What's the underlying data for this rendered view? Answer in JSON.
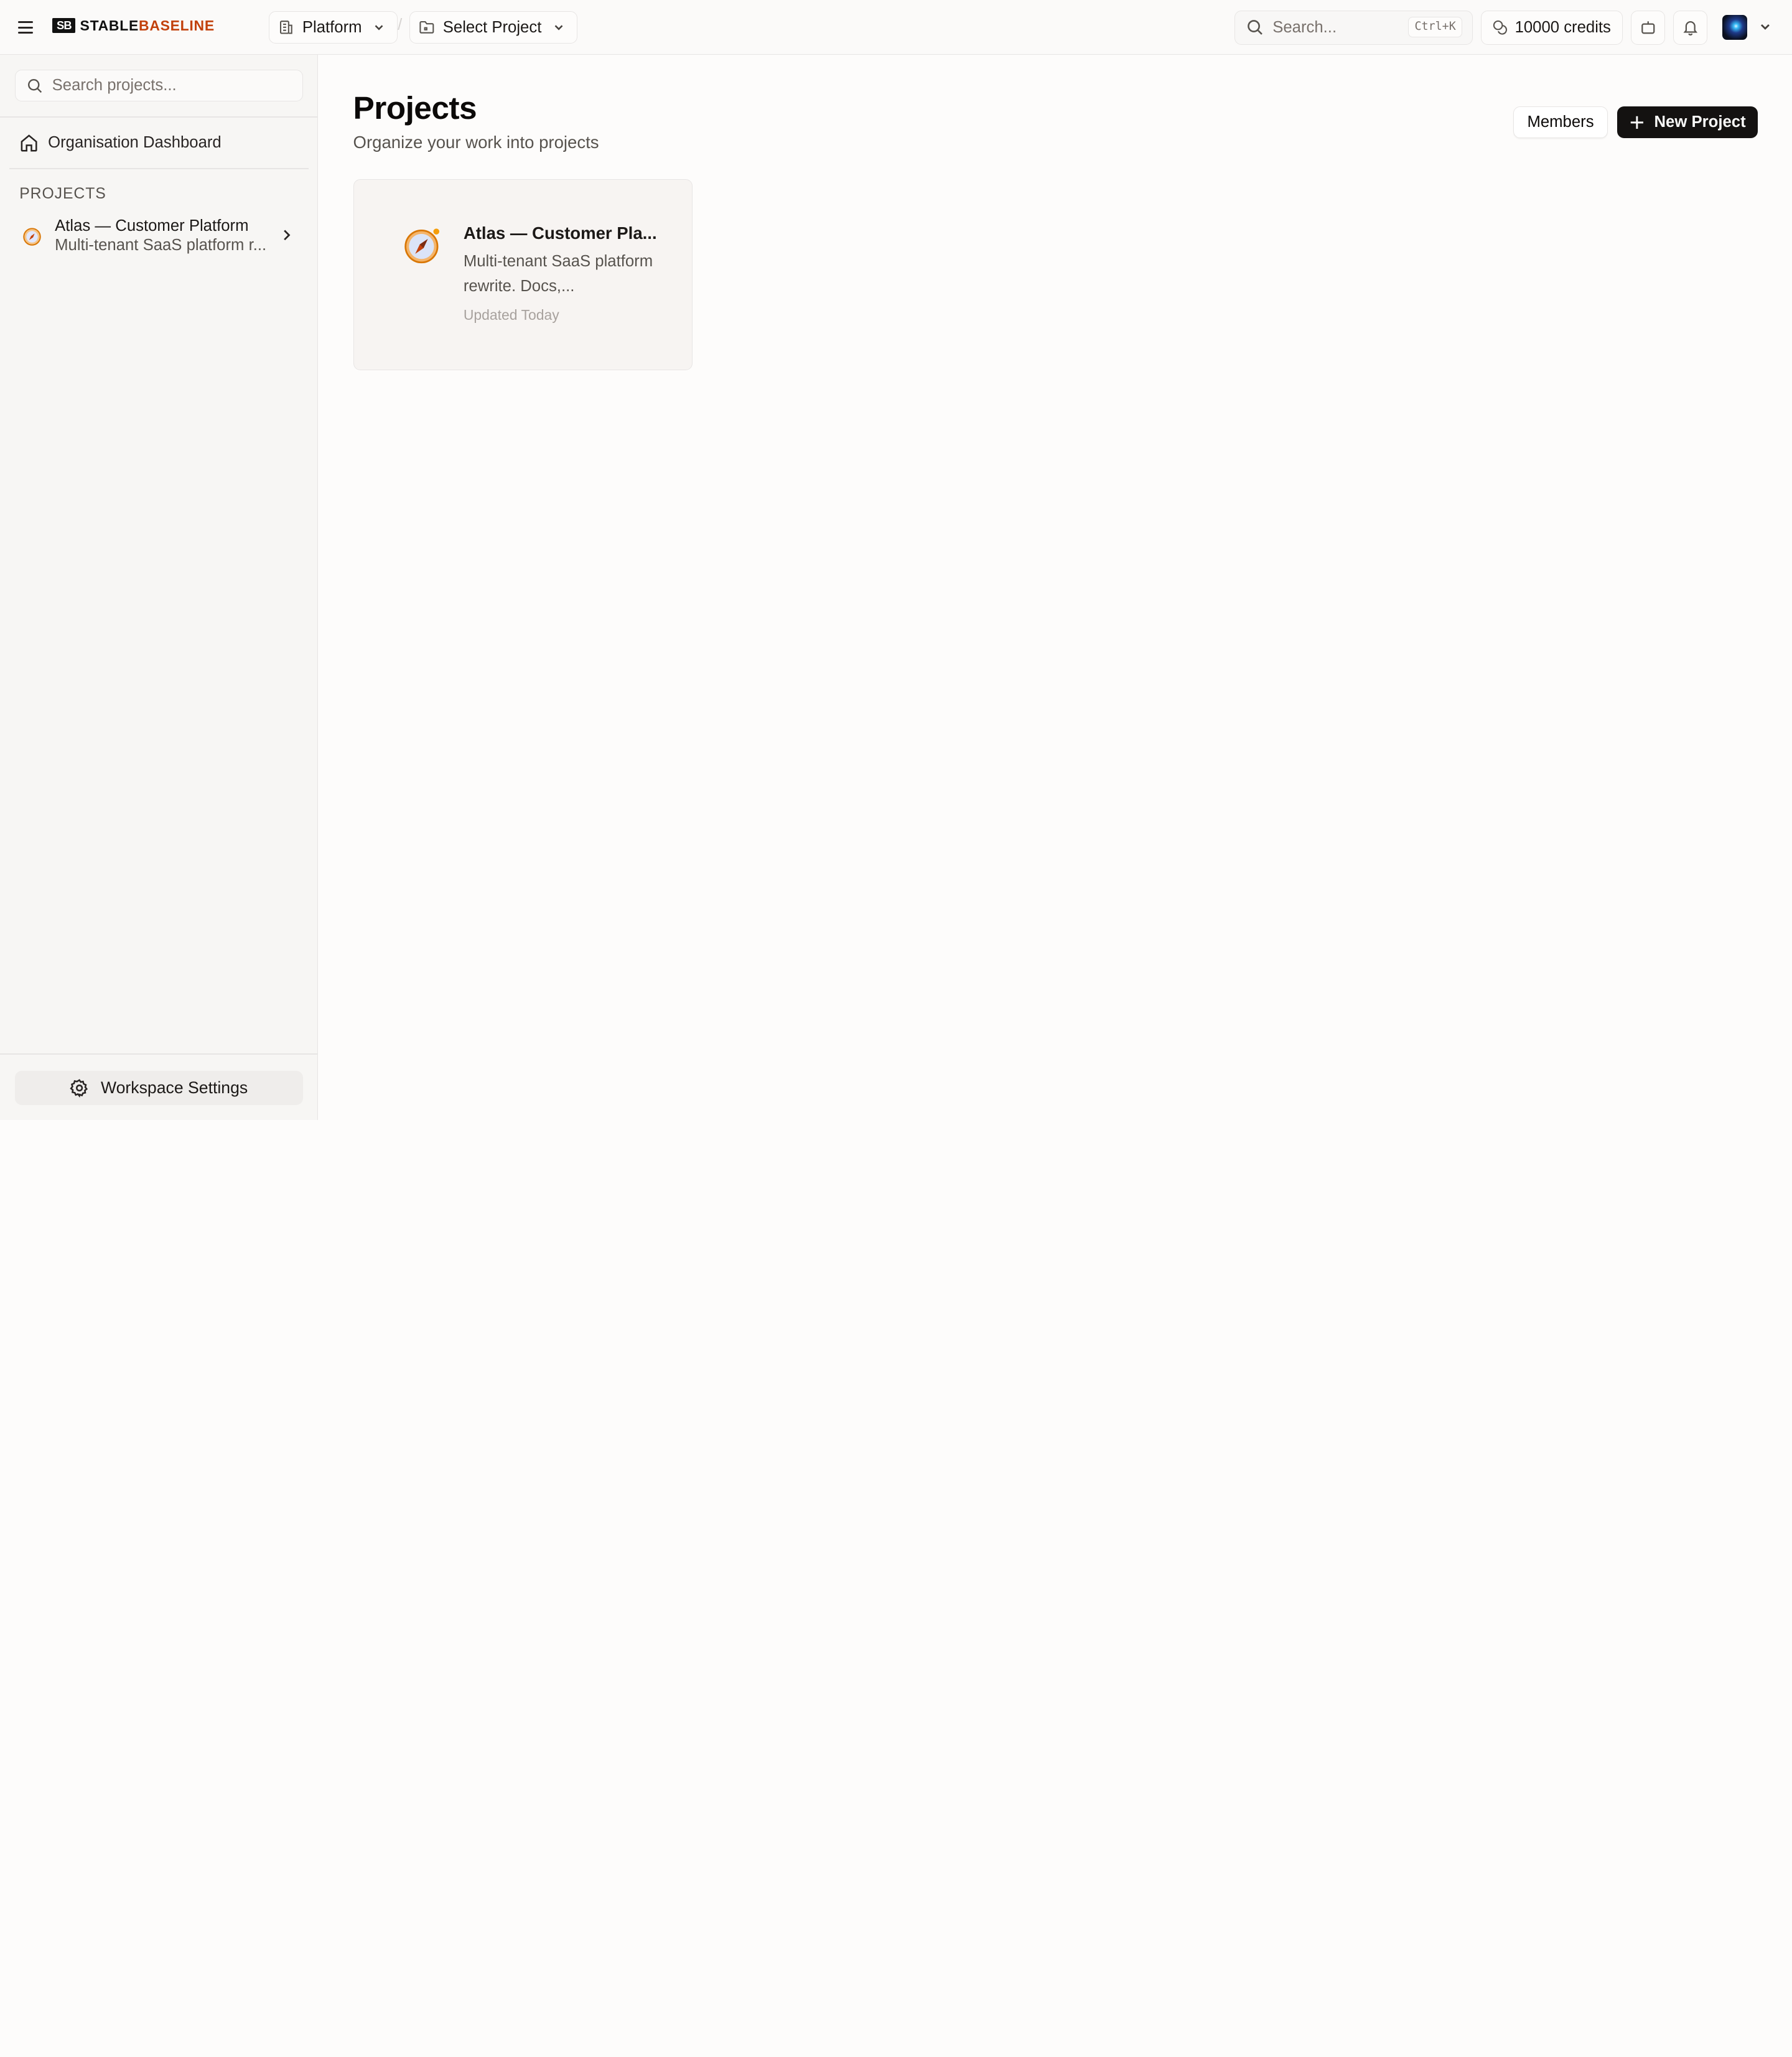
{
  "header": {
    "logo": {
      "mark": "SB",
      "text_primary": "STABLE",
      "text_accent": "BASELINE"
    },
    "org_selector": {
      "label": "Platform",
      "icon": "building-icon"
    },
    "breadcrumb_separator": "/",
    "project_selector": {
      "label": "Select Project",
      "icon": "folder-icon"
    },
    "search": {
      "placeholder": "Search...",
      "shortcut": "Ctrl+K"
    },
    "credits": {
      "label": "10000 credits",
      "icon": "coins-icon"
    },
    "icons": [
      "menu-icon",
      "bot-icon",
      "bell-icon",
      "chevron-down-icon"
    ]
  },
  "sidebar": {
    "search": {
      "placeholder": "Search projects..."
    },
    "dashboard": {
      "label": "Organisation Dashboard",
      "icon": "home-icon"
    },
    "projects_heading": "PROJECTS",
    "projects": [
      {
        "name": "Atlas — Customer Platform",
        "description": "Multi-tenant SaaS platform r...",
        "icon": "compass-emoji"
      }
    ],
    "workspace_settings": {
      "label": "Workspace Settings",
      "icon": "gear-icon"
    }
  },
  "main": {
    "title": "Projects",
    "subtitle": "Organize your work into projects",
    "members_button": "Members",
    "new_project_button": "New Project",
    "cards": [
      {
        "title": "Atlas — Customer Pla...",
        "description": "Multi-tenant SaaS platform rewrite. Docs,...",
        "updated": "Updated Today",
        "icon": "compass-emoji"
      }
    ]
  },
  "colors": {
    "brand_accent": "#c2410c",
    "primary_button": "#141211",
    "background": "#fdfcfb",
    "sidebar_bg": "#f7f6f4"
  }
}
